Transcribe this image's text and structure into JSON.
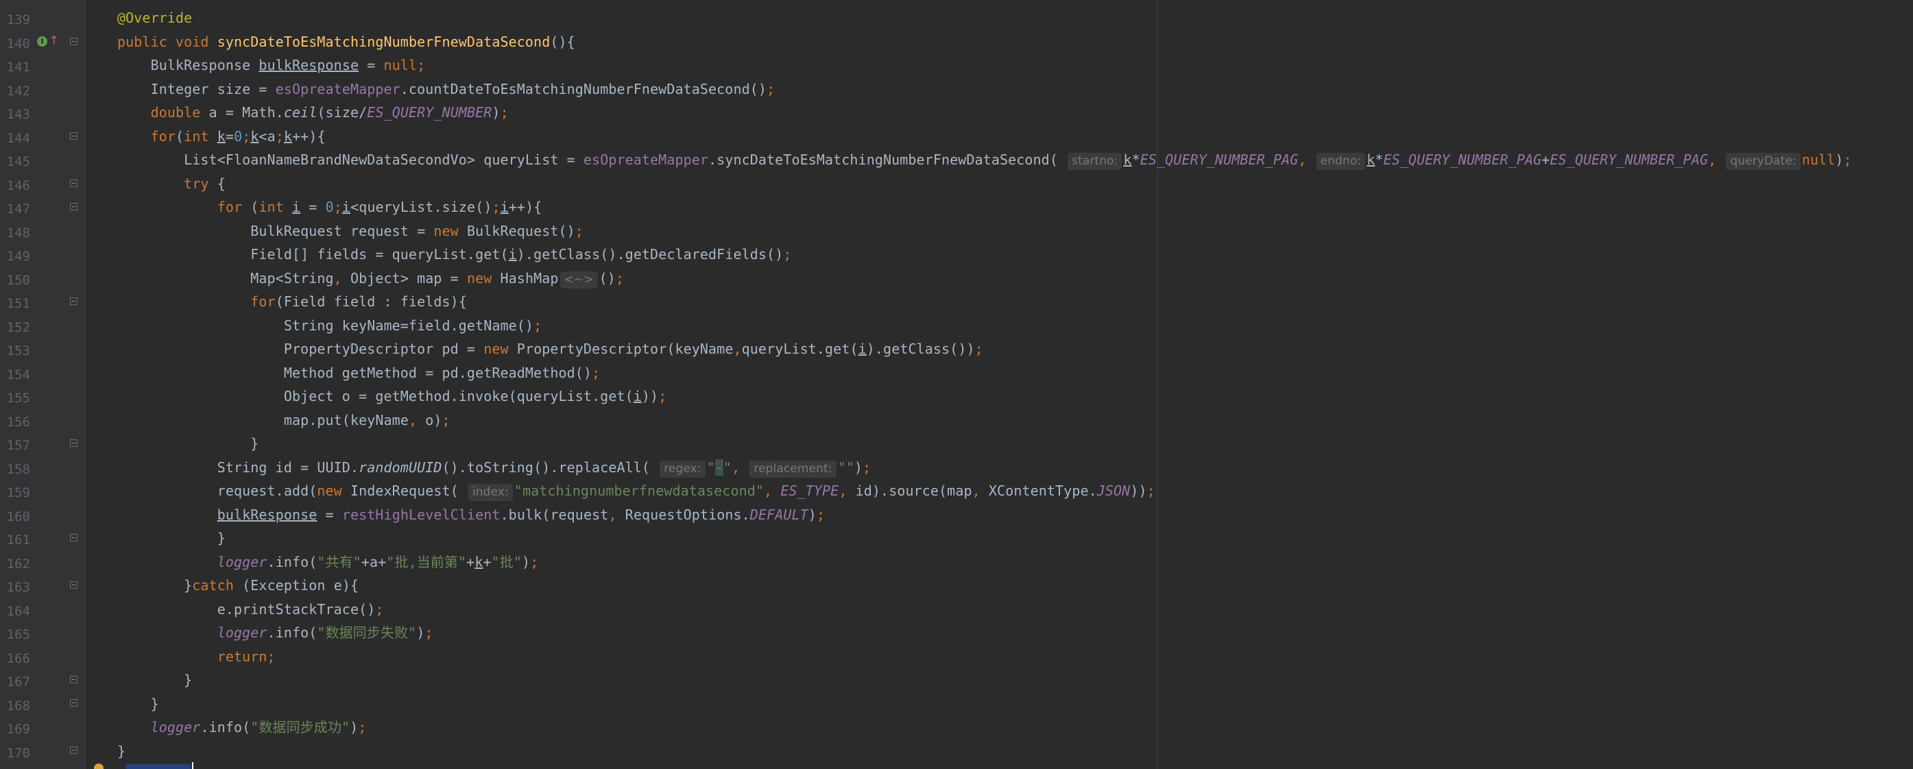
{
  "editor": {
    "line_numbers": [
      "139",
      "140",
      "141",
      "142",
      "143",
      "144",
      "145",
      "146",
      "147",
      "148",
      "149",
      "150",
      "151",
      "152",
      "153",
      "154",
      "155",
      "156",
      "157",
      "158",
      "159",
      "160",
      "161",
      "162",
      "163",
      "164",
      "165",
      "166",
      "167",
      "168",
      "169",
      "170"
    ],
    "hints": {
      "startno": "startno:",
      "endno": "endno:",
      "queryDate": "queryDate:",
      "regex": "regex:",
      "replacement": "replacement:",
      "index": "index:"
    }
  },
  "colors": {
    "background": "#2b2b2b",
    "gutter": "#313335",
    "keyword": "#cc7832",
    "annotation": "#bbb529",
    "method_decl": "#ffc66d",
    "field": "#9876aa",
    "string": "#6a8759",
    "number": "#6897bb",
    "default_text": "#a9b7c6"
  }
}
